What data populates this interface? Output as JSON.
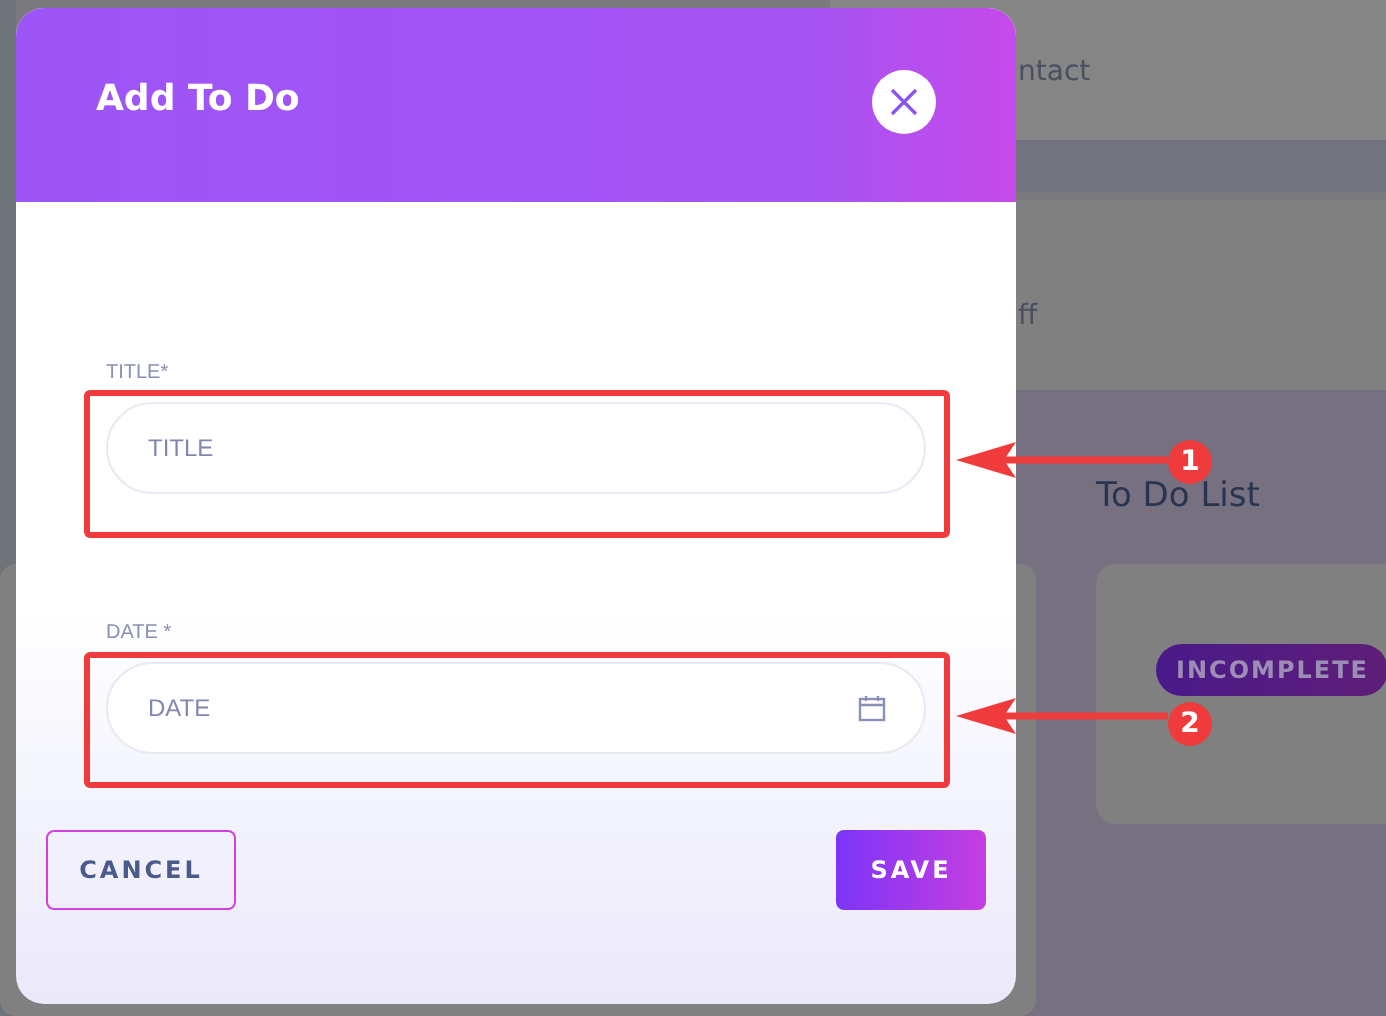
{
  "background": {
    "texts": [
      {
        "kind": "sub",
        "text": "ntact"
      },
      {
        "kind": "sub",
        "text": "ff"
      },
      {
        "kind": "section",
        "text": "To Do List"
      }
    ],
    "badge": "INCOMPLETE"
  },
  "dialog": {
    "title": "Add To Do",
    "fields": [
      {
        "label": "TITLE*",
        "placeholder": "TITLE",
        "kind": "text"
      },
      {
        "label": "DATE *",
        "placeholder": "DATE",
        "kind": "date"
      }
    ],
    "buttons": [
      {
        "label": "CANCEL",
        "kind": "outline"
      },
      {
        "label": "SAVE",
        "kind": "primary"
      }
    ]
  },
  "callouts": [
    {
      "number": "1"
    },
    {
      "number": "2"
    }
  ]
}
